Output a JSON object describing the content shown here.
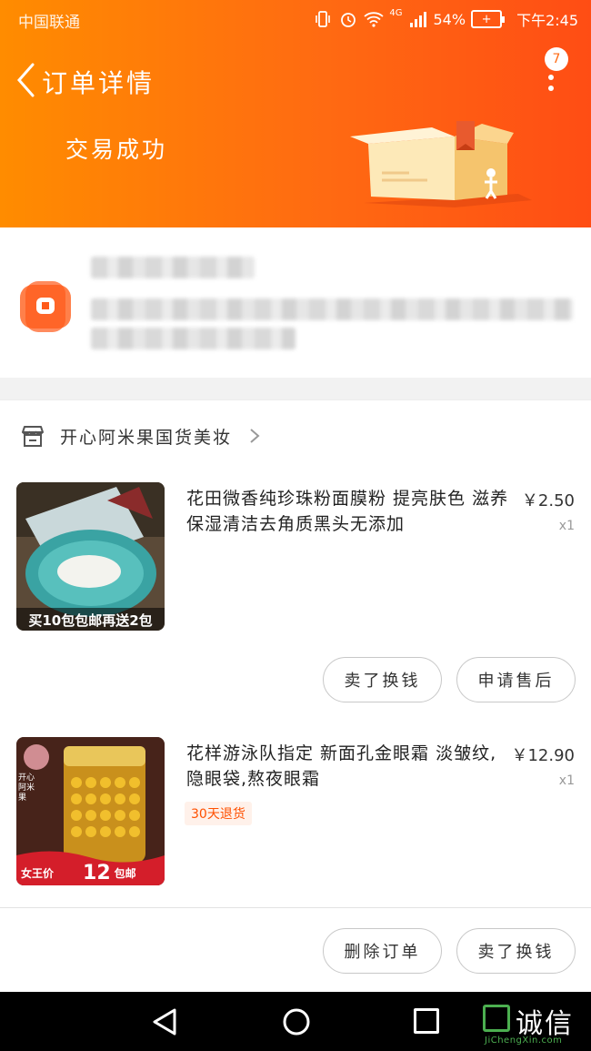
{
  "status_bar": {
    "carrier": "中国联通",
    "network": "4G",
    "battery": "54%",
    "time": "下午2:45"
  },
  "nav": {
    "title": "订单详情",
    "more_badge": "7"
  },
  "order_status": "交易成功",
  "shop": {
    "name": "开心阿米果国货美妆"
  },
  "items": [
    {
      "title": "花田微香纯珍珠粉面膜粉 提亮肤色 滋养保湿清洁去角质黑头无添加",
      "price": "￥2.50",
      "qty": "x1",
      "thumb_caption": "买10包包邮再送2包",
      "actions": [
        "卖了换钱",
        "申请售后"
      ]
    },
    {
      "title": "花样游泳队指定 新面孔金眼霜 淡皱纹,隐眼袋,熬夜眼霜",
      "price": "￥12.90",
      "qty": "x1",
      "tag": "30天退货",
      "thumb_caption_left": "女王价",
      "thumb_caption_price": "12",
      "thumb_caption_right": "包邮",
      "thumb_brand": "开心阿米果"
    }
  ],
  "footer_actions": [
    "删除订单",
    "卖了换钱"
  ],
  "watermark": {
    "text": "诚信",
    "sub": "JiChengXin.com"
  },
  "colors": {
    "header_start": "#ff8c00",
    "header_end": "#ff4d14",
    "accent": "#ff5000"
  }
}
